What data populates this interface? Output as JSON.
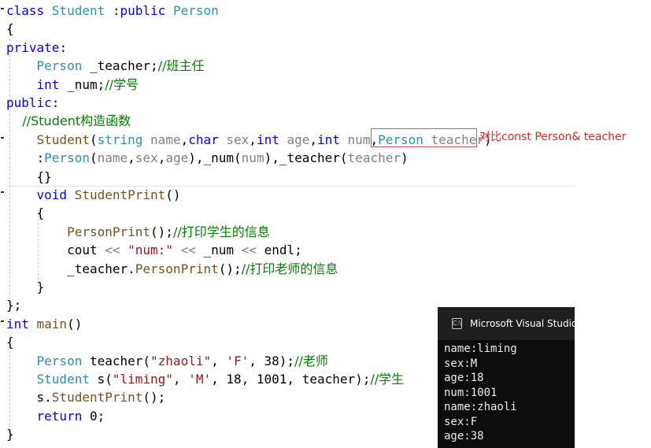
{
  "code": {
    "lines": [
      [
        {
          "t": "class ",
          "c": "kw"
        },
        {
          "t": "Student ",
          "c": "ty"
        },
        {
          "t": ":",
          "c": ""
        },
        {
          "t": "public ",
          "c": "kw"
        },
        {
          "t": "Person",
          "c": "ty"
        }
      ],
      [
        {
          "t": "{",
          "c": ""
        }
      ],
      [
        {
          "t": "private",
          "c": "kw"
        },
        {
          "t": ":",
          "c": ""
        }
      ],
      [
        {
          "t": "    Person ",
          "c": "ty"
        },
        {
          "t": "_teacher;",
          "c": ""
        },
        {
          "t": "//班主任",
          "c": "cm"
        }
      ],
      [
        {
          "t": "    int ",
          "c": "kw"
        },
        {
          "t": "_num;",
          "c": ""
        },
        {
          "t": "//学号",
          "c": "cm"
        }
      ],
      [
        {
          "t": "public",
          "c": "kw"
        },
        {
          "t": ":",
          "c": ""
        }
      ],
      [
        {
          "t": "    //Student构造函数",
          "c": "cm"
        }
      ],
      [
        {
          "t": "    Student",
          "c": "fn"
        },
        {
          "t": "(",
          "c": ""
        },
        {
          "t": "string ",
          "c": "ty"
        },
        {
          "t": "name",
          "c": "pa"
        },
        {
          "t": ",",
          "c": ""
        },
        {
          "t": "char ",
          "c": "kw"
        },
        {
          "t": "sex",
          "c": "pa"
        },
        {
          "t": ",",
          "c": ""
        },
        {
          "t": "int ",
          "c": "kw"
        },
        {
          "t": "age",
          "c": "pa"
        },
        {
          "t": ",",
          "c": ""
        },
        {
          "t": "int ",
          "c": "kw"
        },
        {
          "t": "num",
          "c": "pa"
        },
        {
          "t": ",",
          "c": ""
        },
        {
          "t": "Person ",
          "c": "ty"
        },
        {
          "t": "teacher",
          "c": "pa"
        },
        {
          "t": ")",
          "c": ""
        }
      ],
      [
        {
          "t": "    :",
          "c": ""
        },
        {
          "t": "Person",
          "c": "ty"
        },
        {
          "t": "(",
          "c": ""
        },
        {
          "t": "name",
          "c": "pa"
        },
        {
          "t": ",",
          "c": ""
        },
        {
          "t": "sex",
          "c": "pa"
        },
        {
          "t": ",",
          "c": ""
        },
        {
          "t": "age",
          "c": "pa"
        },
        {
          "t": "),_num(",
          "c": ""
        },
        {
          "t": "num",
          "c": "pa"
        },
        {
          "t": "),_teacher(",
          "c": ""
        },
        {
          "t": "teacher",
          "c": "pa"
        },
        {
          "t": ")",
          "c": ""
        }
      ],
      [
        {
          "t": "    {}",
          "c": ""
        }
      ],
      [
        {
          "t": "    void ",
          "c": "kw"
        },
        {
          "t": "StudentPrint",
          "c": "fn"
        },
        {
          "t": "()",
          "c": ""
        }
      ],
      [
        {
          "t": "    {",
          "c": ""
        }
      ],
      [
        {
          "t": "        PersonPrint",
          "c": "fn"
        },
        {
          "t": "();",
          "c": ""
        },
        {
          "t": "//打印学生的信息",
          "c": "cm"
        }
      ],
      [
        {
          "t": "        cout ",
          "c": ""
        },
        {
          "t": "<< ",
          "c": "pa"
        },
        {
          "t": "\"num:\" ",
          "c": "st"
        },
        {
          "t": "<< ",
          "c": "pa"
        },
        {
          "t": "_num ",
          "c": ""
        },
        {
          "t": "<< ",
          "c": "pa"
        },
        {
          "t": "endl;",
          "c": ""
        }
      ],
      [
        {
          "t": "        _teacher.",
          "c": ""
        },
        {
          "t": "PersonPrint",
          "c": "fn"
        },
        {
          "t": "();",
          "c": ""
        },
        {
          "t": "//打印老师的信息",
          "c": "cm"
        }
      ],
      [
        {
          "t": "    }",
          "c": ""
        }
      ],
      [
        {
          "t": "};",
          "c": ""
        }
      ],
      [
        {
          "t": "int ",
          "c": "kw"
        },
        {
          "t": "main",
          "c": "fn"
        },
        {
          "t": "()",
          "c": ""
        }
      ],
      [
        {
          "t": "{",
          "c": ""
        }
      ],
      [
        {
          "t": "    Person ",
          "c": "ty"
        },
        {
          "t": "teacher(",
          "c": ""
        },
        {
          "t": "\"zhaoli\"",
          "c": "st"
        },
        {
          "t": ", ",
          "c": ""
        },
        {
          "t": "'F'",
          "c": "st"
        },
        {
          "t": ", 38);",
          "c": ""
        },
        {
          "t": "//老师",
          "c": "cm"
        }
      ],
      [
        {
          "t": "    Student ",
          "c": "ty"
        },
        {
          "t": "s(",
          "c": ""
        },
        {
          "t": "\"liming\"",
          "c": "st"
        },
        {
          "t": ", ",
          "c": ""
        },
        {
          "t": "'M'",
          "c": "st"
        },
        {
          "t": ", 18, 1001, teacher);",
          "c": ""
        },
        {
          "t": "//学生",
          "c": "cm"
        }
      ],
      [
        {
          "t": "    s.",
          "c": ""
        },
        {
          "t": "StudentPrint",
          "c": "fn"
        },
        {
          "t": "();",
          "c": ""
        }
      ],
      [
        {
          "t": "    return ",
          "c": "kw"
        },
        {
          "t": "0;",
          "c": ""
        }
      ],
      [
        {
          "t": "}",
          "c": ""
        }
      ]
    ]
  },
  "annotation": {
    "text": "对比const Person& teacher"
  },
  "console": {
    "title": "Microsoft Visual Studio",
    "output": [
      "name:liming",
      "sex:M",
      "age:18",
      "num:1001",
      "name:zhaoli",
      "sex:F",
      "age:38"
    ]
  },
  "colors": {
    "keyword": "#0000ff",
    "type": "#2b91af",
    "function": "#74531f",
    "parameter": "#808080",
    "string": "#a31515",
    "comment": "#008000",
    "annotation": "#ee2222"
  }
}
